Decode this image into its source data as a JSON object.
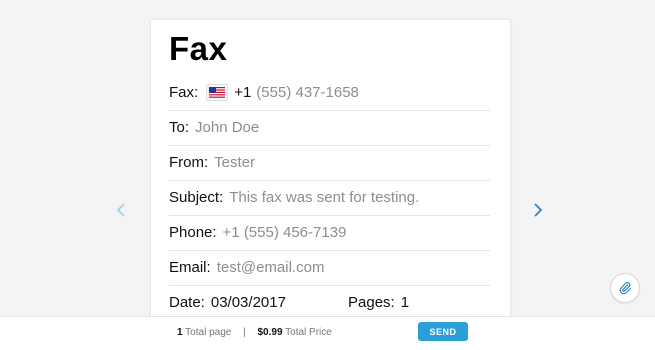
{
  "form": {
    "title": "Fax",
    "fax": {
      "label": "Fax:",
      "country_code": "+1",
      "placeholder": "(555) 437-1658"
    },
    "to": {
      "label": "To:",
      "placeholder": "John Doe"
    },
    "from": {
      "label": "From:",
      "placeholder": "Tester"
    },
    "subject": {
      "label": "Subject:",
      "placeholder": "This fax was sent for testing."
    },
    "phone": {
      "label": "Phone:",
      "placeholder": "+1 (555) 456-7139"
    },
    "email": {
      "label": "Email:",
      "placeholder": "test@email.com"
    },
    "date": {
      "label": "Date:",
      "value": "03/03/2017"
    },
    "pages": {
      "label": "Pages:",
      "value": "1"
    }
  },
  "footer": {
    "page_count": "1",
    "page_text": "Total page",
    "separator": "|",
    "price": "$0.99",
    "price_text": "Total Price",
    "send_label": "SEND"
  },
  "icons": {
    "flag": "us-flag-icon",
    "prev": "chevron-left-icon",
    "next": "chevron-right-icon",
    "attach": "paperclip-icon"
  },
  "colors": {
    "accent": "#2a9fd8",
    "placeholder": "#8e8e8e",
    "background": "#f4f4f5"
  }
}
